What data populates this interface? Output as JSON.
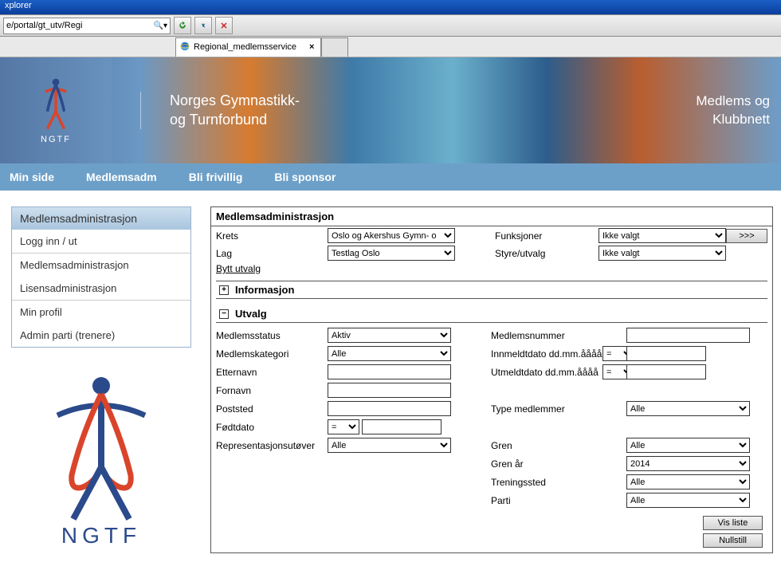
{
  "browser": {
    "title_suffix": "xplorer",
    "address": "e/portal/gt_utv/Regi",
    "tab_label": "Regional_medlemsservice"
  },
  "banner": {
    "org_line1": "Norges Gymnastikk-",
    "org_line2": "og Turnforbund",
    "logo_label": "NGTF",
    "right_line1": "Medlems og",
    "right_line2": "Klubbnett"
  },
  "nav": {
    "items": [
      "Min side",
      "Medlemsadm",
      "Bli frivillig",
      "Bli sponsor"
    ]
  },
  "sidebar": {
    "header": "Medlemsadministrasjon",
    "groups": [
      [
        "Logg inn / ut"
      ],
      [
        "Medlemsadministrasjon",
        "Lisensadministrasjon"
      ],
      [
        "Min profil",
        "Admin parti (trenere)"
      ]
    ],
    "logo_label": "NGTF"
  },
  "panel": {
    "title": "Medlemsadministrasjon",
    "top": {
      "krets_label": "Krets",
      "krets_value": "Oslo og Akershus Gymn- o",
      "lag_label": "Lag",
      "lag_value": "Testlag Oslo",
      "bytt": "Bytt utvalg",
      "funksjoner_label": "Funksjoner",
      "funksjoner_value": "Ikke valgt",
      "styre_label": "Styre/utvalg",
      "styre_value": "Ikke valgt",
      "go_btn": ">>>"
    },
    "info_header": "Informasjon",
    "utvalg_header": "Utvalg",
    "utvalg": {
      "medlemsstatus_label": "Medlemsstatus",
      "medlemsstatus_value": "Aktiv",
      "medlemskategori_label": "Medlemskategori",
      "medlemskategori_value": "Alle",
      "etternavn_label": "Etternavn",
      "fornavn_label": "Fornavn",
      "poststed_label": "Poststed",
      "fodtdato_label": "Fødtdato",
      "fodtdato_op": "=",
      "repr_label": "Representasjonsutøver",
      "repr_value": "Alle",
      "medlemsnummer_label": "Medlemsnummer",
      "innmeldt_label": "Innmeldtdato dd.mm.åååå",
      "innmeldt_op": "=",
      "utmeldt_label": "Utmeldtdato dd.mm.åååå",
      "utmeldt_op": "=",
      "type_label": "Type medlemmer",
      "type_value": "Alle",
      "gren_label": "Gren",
      "gren_value": "Alle",
      "grenar_label": "Gren år",
      "grenar_value": "2014",
      "treningssted_label": "Treningssted",
      "treningssted_value": "Alle",
      "parti_label": "Parti",
      "parti_value": "Alle"
    },
    "actions": {
      "vis": "Vis liste",
      "nullstill": "Nullstill"
    }
  }
}
